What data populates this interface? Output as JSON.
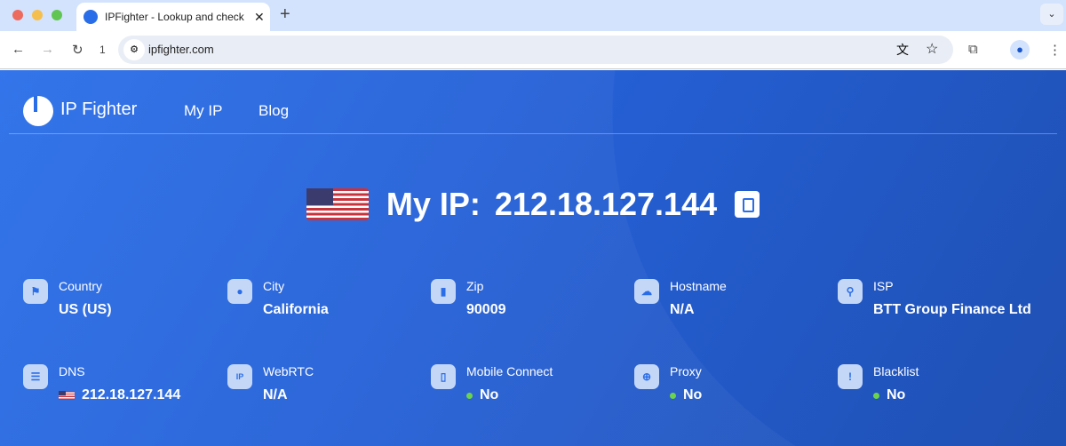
{
  "browser": {
    "tab_title": "IPFighter - Lookup and check",
    "url": "ipfighter.com",
    "extra_count": "1"
  },
  "header": {
    "brand": "IP Fighter",
    "nav": [
      "My IP",
      "Blog"
    ]
  },
  "hero": {
    "label": "My IP:",
    "ip": "212.18.127.144"
  },
  "items": [
    {
      "label": "Country",
      "value": "US (US)",
      "icon": "flag-icon"
    },
    {
      "label": "City",
      "value": "California",
      "icon": "location-pin-icon"
    },
    {
      "label": "Zip",
      "value": "90009",
      "icon": "mailbox-icon"
    },
    {
      "label": "Hostname",
      "value": "N/A",
      "icon": "cloud-icon"
    },
    {
      "label": "ISP",
      "value": "BTT Group Finance Ltd",
      "icon": "antenna-icon"
    },
    {
      "label": "DNS",
      "value": "212.18.127.144",
      "icon": "server-icon"
    },
    {
      "label": "WebRTC",
      "value": "N/A",
      "icon": "ip-icon"
    },
    {
      "label": "Mobile Connect",
      "value": "No",
      "icon": "mobile-icon"
    },
    {
      "label": "Proxy",
      "value": "No",
      "icon": "globe-icon"
    },
    {
      "label": "Blacklist",
      "value": "No",
      "icon": "alert-icon"
    }
  ],
  "colors": {
    "accent": "#2a6de8",
    "status_ok": "#6cd44a"
  }
}
